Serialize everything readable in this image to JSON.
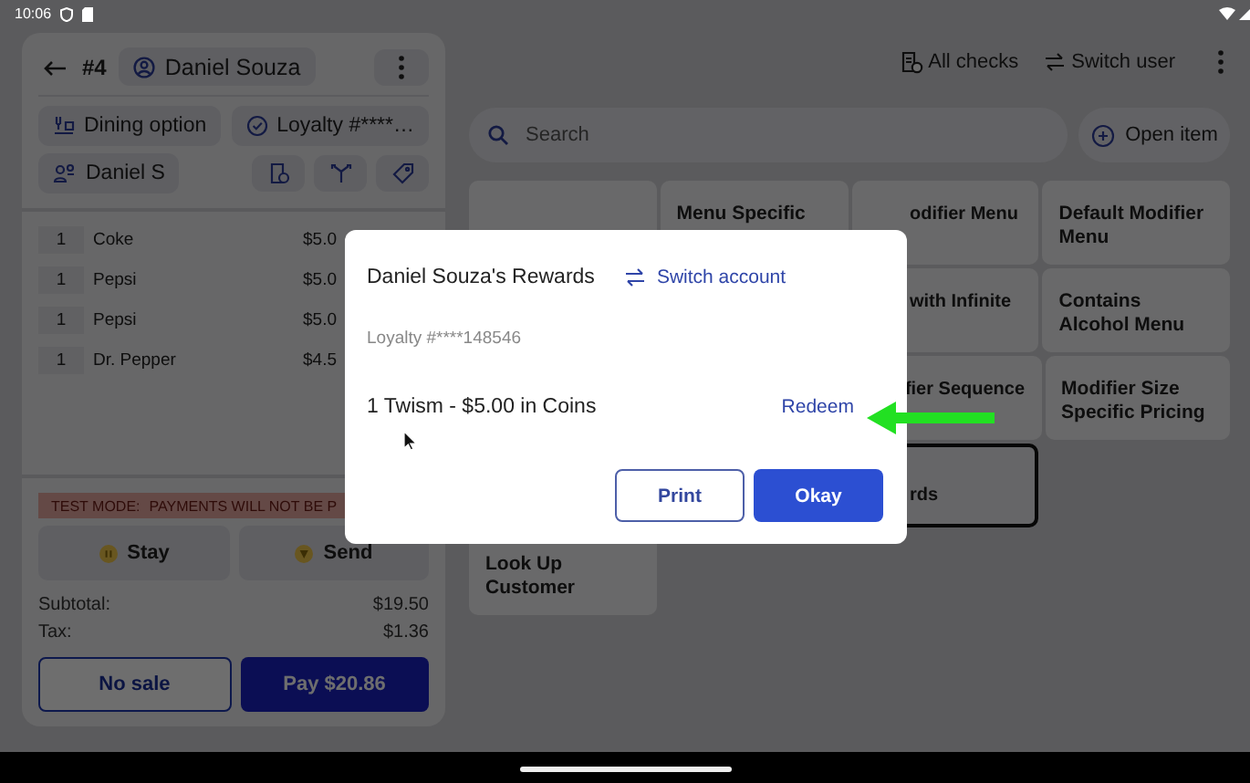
{
  "status_bar": {
    "time": "10:06"
  },
  "order_panel": {
    "order_number": "#4",
    "customer": "Daniel Souza",
    "chips": [
      {
        "kind": "dining",
        "label": "Dining option"
      },
      {
        "kind": "loyalty",
        "label": "Loyalty #****…"
      },
      {
        "kind": "guest",
        "label": "Daniel S"
      }
    ],
    "items": [
      {
        "qty": "1",
        "name": "Coke",
        "price": "$5.0"
      },
      {
        "qty": "1",
        "name": "Pepsi",
        "price": "$5.0"
      },
      {
        "qty": "1",
        "name": "Pepsi",
        "price": "$5.0"
      },
      {
        "qty": "1",
        "name": "Dr. Pepper",
        "price": "$4.5"
      }
    ],
    "test_banner": {
      "title": "TEST MODE:",
      "message": "PAYMENTS WILL NOT BE P"
    },
    "actions": [
      {
        "kind": "stay",
        "label": "Stay"
      },
      {
        "kind": "send",
        "label": "Send"
      }
    ],
    "totals": [
      {
        "label": "Subtotal:",
        "value": "$19.50"
      },
      {
        "label": "Tax:",
        "value": "$1.36"
      }
    ],
    "buttons": [
      {
        "kind": "outline",
        "label": "No sale"
      },
      {
        "kind": "primary",
        "label": "Pay $20.86"
      }
    ]
  },
  "header": {
    "actions": [
      {
        "kind": "checks",
        "label": "All checks"
      },
      {
        "kind": "switch",
        "label": "Switch user"
      }
    ]
  },
  "search": {
    "placeholder": "Search"
  },
  "open_item": {
    "label": "Open item"
  },
  "menu_grid": {
    "rows": [
      [
        {
          "kind": "blank",
          "selected": false
        },
        {
          "kind": "full",
          "label": "Menu Specific",
          "selected": false
        },
        {
          "kind": "cut",
          "label": "odifier Menu",
          "selected": false
        },
        {
          "kind": "full",
          "label": "Default Modifier Menu",
          "selected": false
        }
      ],
      [
        {
          "kind": "cut",
          "label": "with Infinite",
          "selected": false
        },
        {
          "kind": "full",
          "label": "Contains Alcohol Menu",
          "selected": false
        }
      ],
      [
        {
          "kind": "cut",
          "label": "fier Sequence",
          "selected": false
        },
        {
          "kind": "full",
          "label": "Modifier Size Specific Pricing",
          "selected": false
        }
      ],
      [
        {
          "kind": "cut",
          "label": "rds",
          "selected": true
        }
      ],
      [
        {
          "kind": "full",
          "label": "Look Up Customer",
          "selected": false
        }
      ]
    ]
  },
  "rewards_dialog": {
    "title": "Daniel Souza's Rewards",
    "switch_label": "Switch account",
    "loyalty": "Loyalty #****148546",
    "rewards": [
      {
        "label": "1 Twism - $5.00 in Coins",
        "action": "Redeem"
      }
    ],
    "buttons": [
      {
        "kind": "outline",
        "label": "Print"
      },
      {
        "kind": "primary",
        "label": "Okay"
      }
    ]
  }
}
